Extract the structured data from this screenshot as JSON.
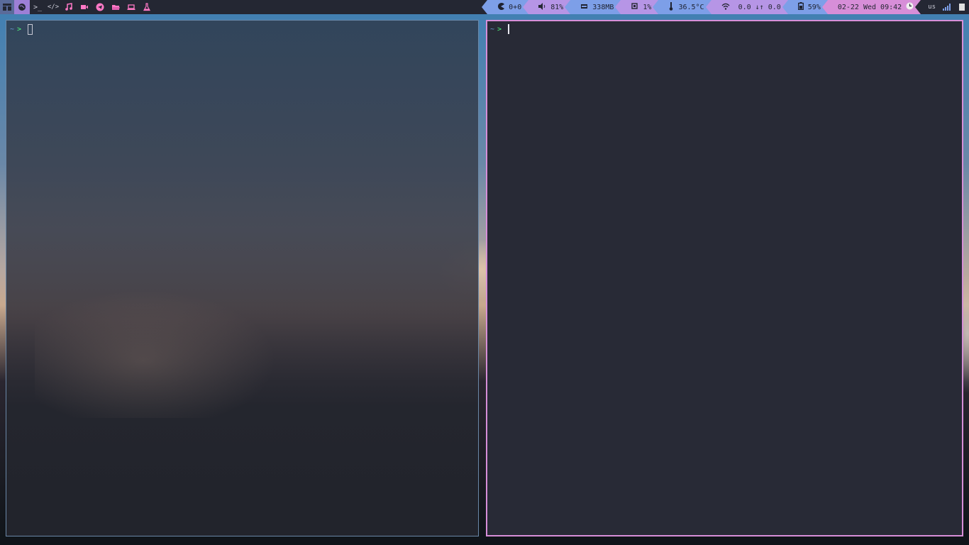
{
  "topbar": {
    "workspaces": [
      {
        "icon": "globe-icon",
        "active": true
      },
      {
        "icon": "terminal-icon",
        "label": ">_"
      },
      {
        "icon": "code-icon"
      },
      {
        "icon": "music-icon"
      },
      {
        "icon": "video-icon"
      },
      {
        "icon": "telegram-icon"
      },
      {
        "icon": "folder-icon"
      },
      {
        "icon": "laptop-icon"
      },
      {
        "icon": "flask-icon"
      }
    ],
    "terminal_ws_label": ">_",
    "code_ws_label": "</>",
    "modules": {
      "updates": "0+0",
      "volume": "81%",
      "memory": "338MB",
      "cpu": "1%",
      "temperature": "36.5°C",
      "network": "0.0 ↓↑ 0.0",
      "battery": "59%",
      "datetime": "02-22 Wed 09:42"
    },
    "keyboard_layout": "us"
  },
  "terminals": {
    "left": {
      "tilde": "~",
      "arrow": ">"
    },
    "right": {
      "tilde": "~",
      "arrow": ">"
    }
  },
  "colors": {
    "bar_bg": "#242733",
    "accent_pink": "#ff79c6",
    "module_blue": "#7d9fe8",
    "module_purple": "#b695e6",
    "module_pink": "#d78ed8",
    "focus_border": "#d78ed8",
    "prompt_green": "#50fa7b"
  }
}
